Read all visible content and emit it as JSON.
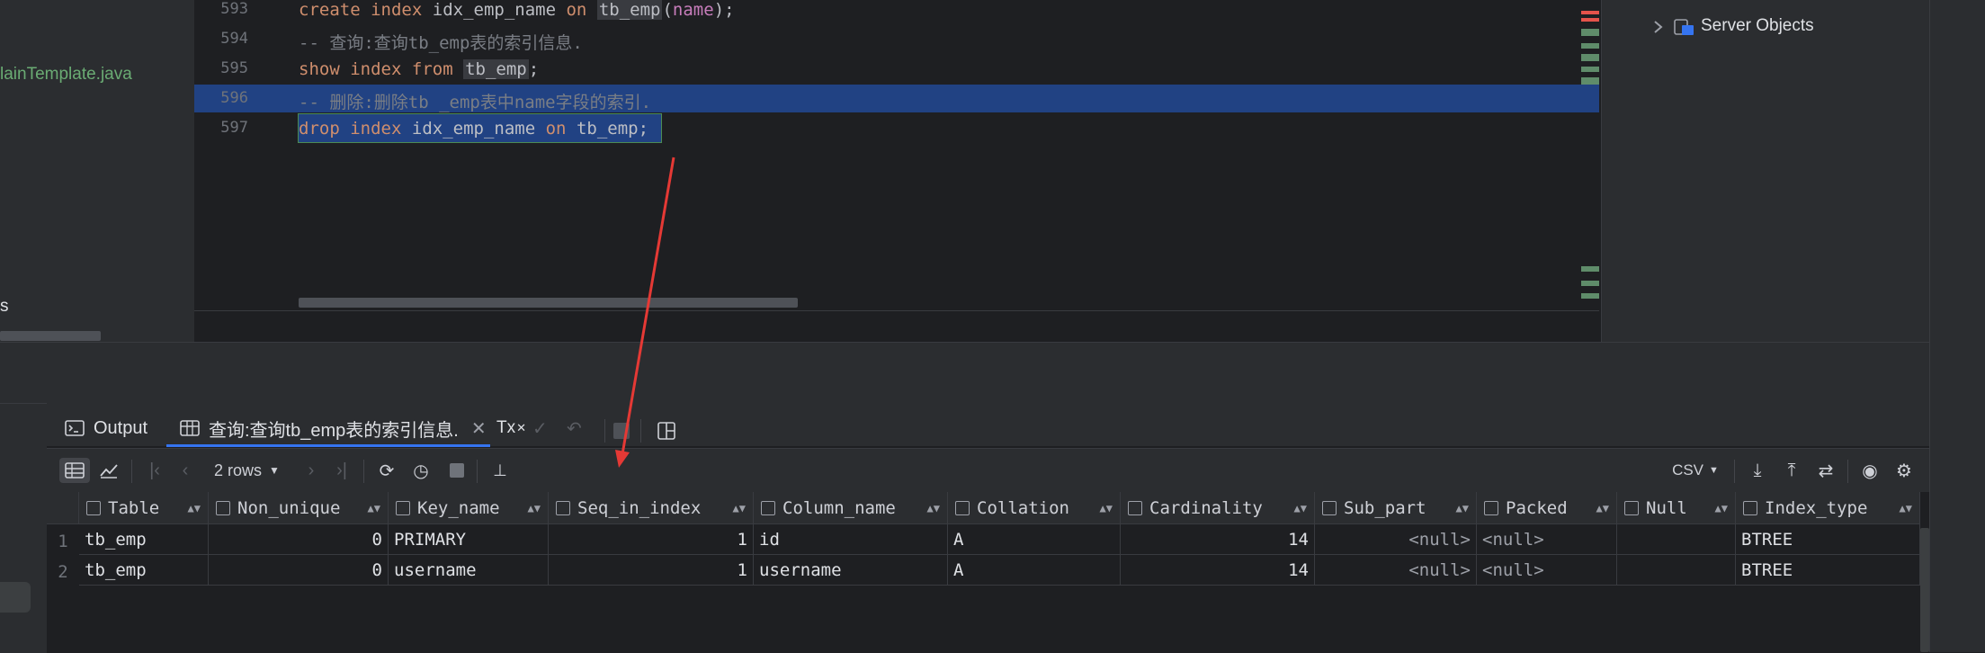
{
  "project": {
    "file_label": "lainTemplate.java",
    "truncated_label": "s"
  },
  "right_panel": {
    "server_objects": "Server Objects"
  },
  "editor": {
    "lines": [
      {
        "no": "593"
      },
      {
        "no": "594"
      },
      {
        "no": "595"
      },
      {
        "no": "596"
      },
      {
        "no": "597"
      }
    ],
    "l593": {
      "k1": "create",
      "k2": "index",
      "idx": "idx_emp_name",
      "k3": "on",
      "tbl": "tb_emp",
      "p1": "(",
      "col": "name",
      "p2": ");"
    },
    "l594": {
      "comment": "-- 查询:查询tb_emp表的索引信息."
    },
    "l595": {
      "k1": "show",
      "k2": "index",
      "k3": "from",
      "tbl": "tb_emp",
      "end": ";"
    },
    "l596": {
      "comment": "-- 删除:删除tb _emp表中name字段的索引."
    },
    "l597": {
      "k1": "drop",
      "k2": "index",
      "idx": "idx_emp_name",
      "k3": "on",
      "tbl": "tb_emp",
      "end": ";"
    }
  },
  "tabs": {
    "output": "Output",
    "query": "查询:查询tb_emp表的索引信息."
  },
  "toolbar": {
    "rows": "2 rows",
    "format": "CSV",
    "tx": "Tx"
  },
  "grid": {
    "columns": [
      "Table",
      "Non_unique",
      "Key_name",
      "Seq_in_index",
      "Column_name",
      "Collation",
      "Cardinality",
      "Sub_part",
      "Packed",
      "Null",
      "Index_type"
    ],
    "rows": [
      {
        "no": "1",
        "cells": [
          "tb_emp",
          "0",
          "PRIMARY",
          "1",
          "id",
          "A",
          "14",
          "<null>",
          "<null>",
          "",
          "BTREE"
        ]
      },
      {
        "no": "2",
        "cells": [
          "tb_emp",
          "0",
          "username",
          "1",
          "username",
          "A",
          "14",
          "<null>",
          "<null>",
          "",
          "BTREE"
        ]
      }
    ]
  },
  "colors": {
    "selection": "#214283",
    "annotation_arrow": "#e53935",
    "accent": "#3574f0"
  }
}
